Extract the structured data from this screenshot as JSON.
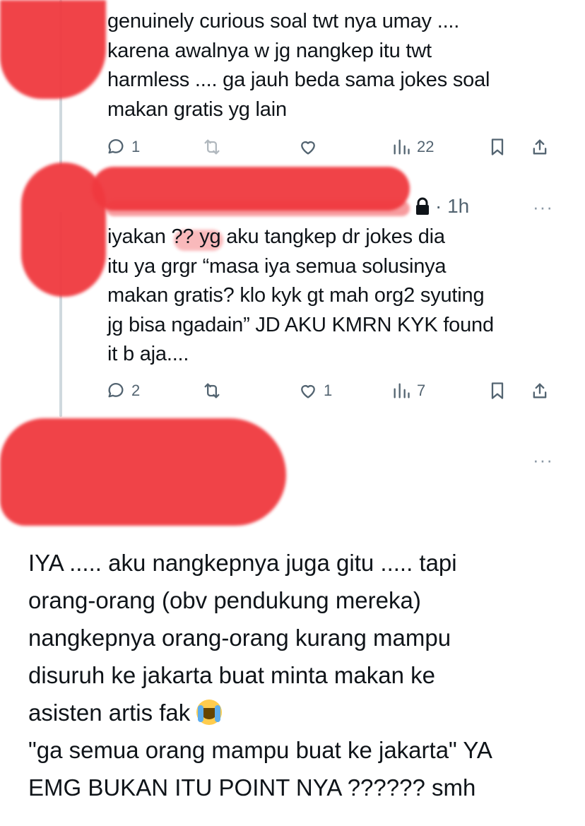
{
  "tweet1": {
    "lines": [
      "genuinely curious soal twt nya umay ....",
      "karena awalnya w jg nangkep itu twt",
      "harmless .... ga jauh beda sama jokes soal",
      "makan gratis yg lain"
    ],
    "reply_count": "1",
    "retweet_count": "",
    "like_count": "",
    "view_count": "22"
  },
  "tweet2": {
    "time": "· 1h",
    "more": "···",
    "lines": [
      "iyakan ?? yg aku tangkep dr jokes dia",
      "itu ya grgr “masa iya semua solusinya",
      "makan gratis? klo kyk gt mah org2 syuting",
      "jg bisa ngadain” JD AKU KMRN KYK found",
      "it b aja...."
    ],
    "reply_count": "2",
    "retweet_count": "",
    "like_count": "1",
    "view_count": "7"
  },
  "tweet3": {
    "more": "···",
    "lines": [
      "IYA ..... aku nangkepnya juga gitu ..... tapi",
      "orang-orang (obv pendukung mereka)",
      "nangkepnya orang-orang kurang mampu",
      "disuruh ke jakarta buat minta makan ke",
      "asisten artis fak",
      "\"ga semua orang mampu buat ke jakarta\" YA",
      "EMG BUKAN ITU POINT NYA ?????? smh"
    ],
    "emoji": "loudly-crying-face"
  },
  "colors": {
    "text": "#0f1419",
    "muted": "#536471",
    "redaction": "#f0393f",
    "thread_line": "#cfd9de"
  }
}
